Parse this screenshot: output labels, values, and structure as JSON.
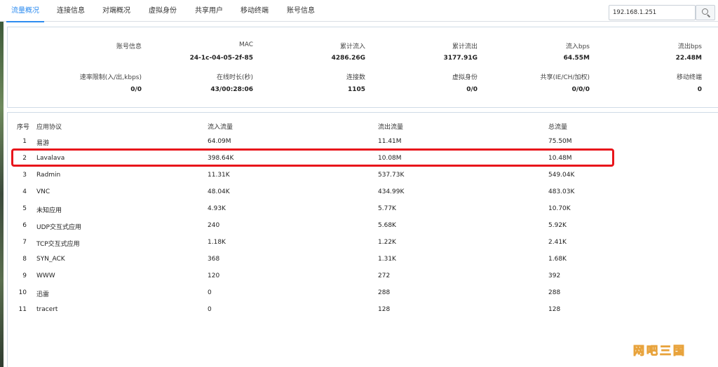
{
  "tabs": [
    {
      "label": "流量概况",
      "active": true
    },
    {
      "label": "连接信息",
      "active": false
    },
    {
      "label": "对端概况",
      "active": false
    },
    {
      "label": "虚拟身份",
      "active": false
    },
    {
      "label": "共享用户",
      "active": false
    },
    {
      "label": "移动终端",
      "active": false
    },
    {
      "label": "账号信息",
      "active": false
    }
  ],
  "search": {
    "value": "192.168.1.251",
    "icon": "search-icon"
  },
  "summary": {
    "row1": [
      {
        "label": "账号信息",
        "value": ""
      },
      {
        "label": "MAC",
        "value": "24-1c-04-05-2f-85"
      },
      {
        "label": "累计流入",
        "value": "4286.26G"
      },
      {
        "label": "累计流出",
        "value": "3177.91G"
      },
      {
        "label": "流入bps",
        "value": "64.55M"
      },
      {
        "label": "流出bps",
        "value": "22.48M"
      }
    ],
    "row2": [
      {
        "label": "速率限制(入/出,kbps)",
        "value": "0/0"
      },
      {
        "label": "在线时长(秒)",
        "value": "43/00:28:06"
      },
      {
        "label": "连接数",
        "value": "1105"
      },
      {
        "label": "虚拟身份",
        "value": "0/0"
      },
      {
        "label": "共享(IE/CH/加权)",
        "value": "0/0/0"
      },
      {
        "label": "移动终端",
        "value": "0"
      }
    ]
  },
  "table": {
    "headers": [
      "序号",
      "应用协议",
      "流入流量",
      "流出流量",
      "总流量"
    ],
    "rows": [
      [
        "1",
        "易游",
        "64.09M",
        "11.41M",
        "75.50M"
      ],
      [
        "2",
        "Lavalava",
        "398.64K",
        "10.08M",
        "10.48M"
      ],
      [
        "3",
        "Radmin",
        "11.31K",
        "537.73K",
        "549.04K"
      ],
      [
        "4",
        "VNC",
        "48.04K",
        "434.99K",
        "483.03K"
      ],
      [
        "5",
        "未知应用",
        "4.93K",
        "5.77K",
        "10.70K"
      ],
      [
        "6",
        "UDP交互式应用",
        "240",
        "5.68K",
        "5.92K"
      ],
      [
        "7",
        "TCP交互式应用",
        "1.18K",
        "1.22K",
        "2.41K"
      ],
      [
        "8",
        "SYN_ACK",
        "368",
        "1.31K",
        "1.68K"
      ],
      [
        "9",
        "WWW",
        "120",
        "272",
        "392"
      ],
      [
        "10",
        "迅雷",
        "0",
        "288",
        "288"
      ],
      [
        "11",
        "tracert",
        "0",
        "128",
        "128"
      ]
    ]
  },
  "watermark": "网吧三国",
  "colors": {
    "accent": "#2d8cf0",
    "highlight": "#e8151b",
    "watermark": "#e8a33c"
  }
}
